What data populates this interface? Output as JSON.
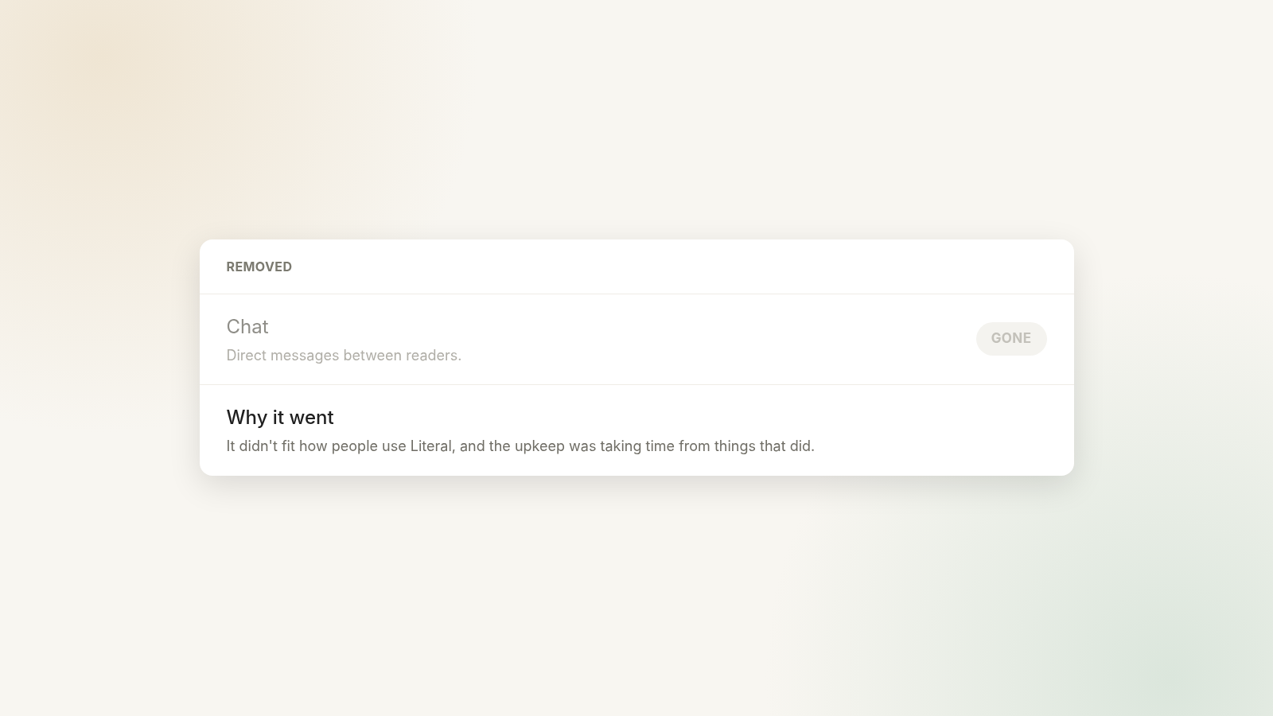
{
  "card": {
    "heading": "REMOVED",
    "rows": [
      {
        "kind": "feature",
        "title": "Chat",
        "description": "Direct messages between readers.",
        "badge": "GONE",
        "disabled": true
      },
      {
        "kind": "note",
        "title": "Why it went",
        "description": "It didn't fit how people use Literal, and the upkeep was taking time from things that did."
      }
    ]
  }
}
